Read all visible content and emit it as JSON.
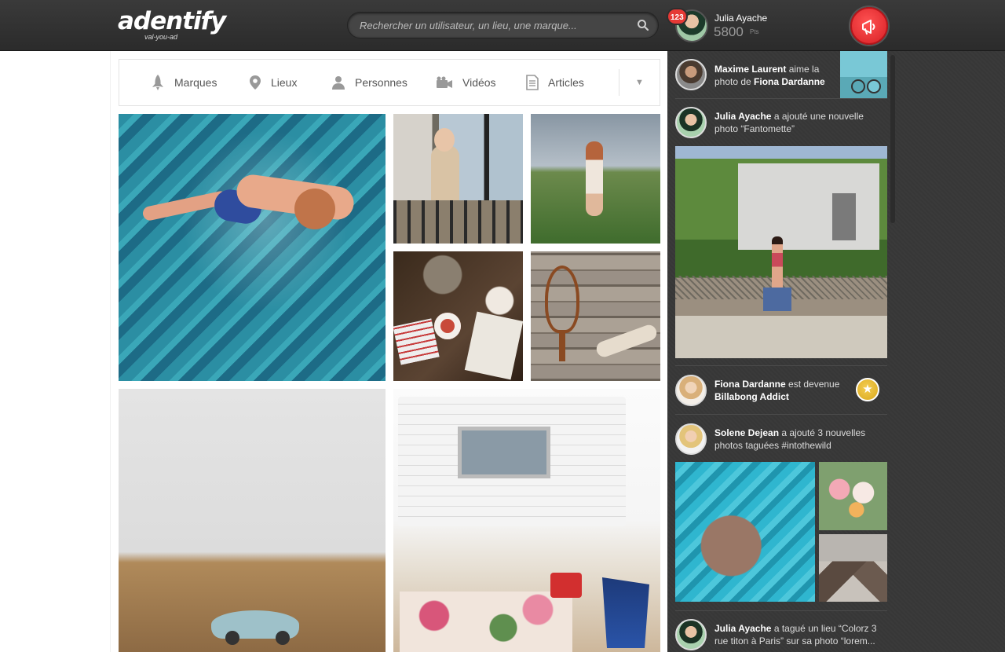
{
  "header": {
    "logo": {
      "word": "adentify",
      "tagline": "val-you-ad"
    },
    "search_placeholder": "Rechercher un utilisateur, un lieu, une marque...",
    "notification_count": "123",
    "user": {
      "name": "Julia Ayache",
      "points": "5800",
      "points_unit": "Pts"
    }
  },
  "filters": [
    {
      "label": "Marques",
      "icon": "rocket-icon"
    },
    {
      "label": "Lieux",
      "icon": "location-pin-icon"
    },
    {
      "label": "Personnes",
      "icon": "person-icon"
    },
    {
      "label": "Vidéos",
      "icon": "video-camera-icon"
    },
    {
      "label": "Articles",
      "icon": "document-icon"
    }
  ],
  "filters_more": "▼",
  "feed": [
    {
      "actor": "Maxime Laurent",
      "text1": " aime la photo de ",
      "target": "Fiona Dardanne"
    },
    {
      "actor": "Julia Ayache",
      "text1": " a ajouté une nouvelle photo “Fantomette”"
    },
    {
      "actor": "Fiona Dardanne",
      "text1": " est devenue ",
      "target": "Billabong Addict",
      "badge": "★"
    },
    {
      "actor": "Solene Dejean",
      "text1": " a ajouté 3 nouvelles photos taguées #intothewild"
    },
    {
      "actor": "Julia Ayache",
      "text1": " a tagué un lieu “Colorz 3 rue titon à Paris” sur sa photo “lorem..."
    }
  ],
  "colors": {
    "header": "#2e2e2e",
    "accent_red": "#e53935",
    "badge_gold": "#e8b82c",
    "sidebar": "#3a3a3a"
  }
}
